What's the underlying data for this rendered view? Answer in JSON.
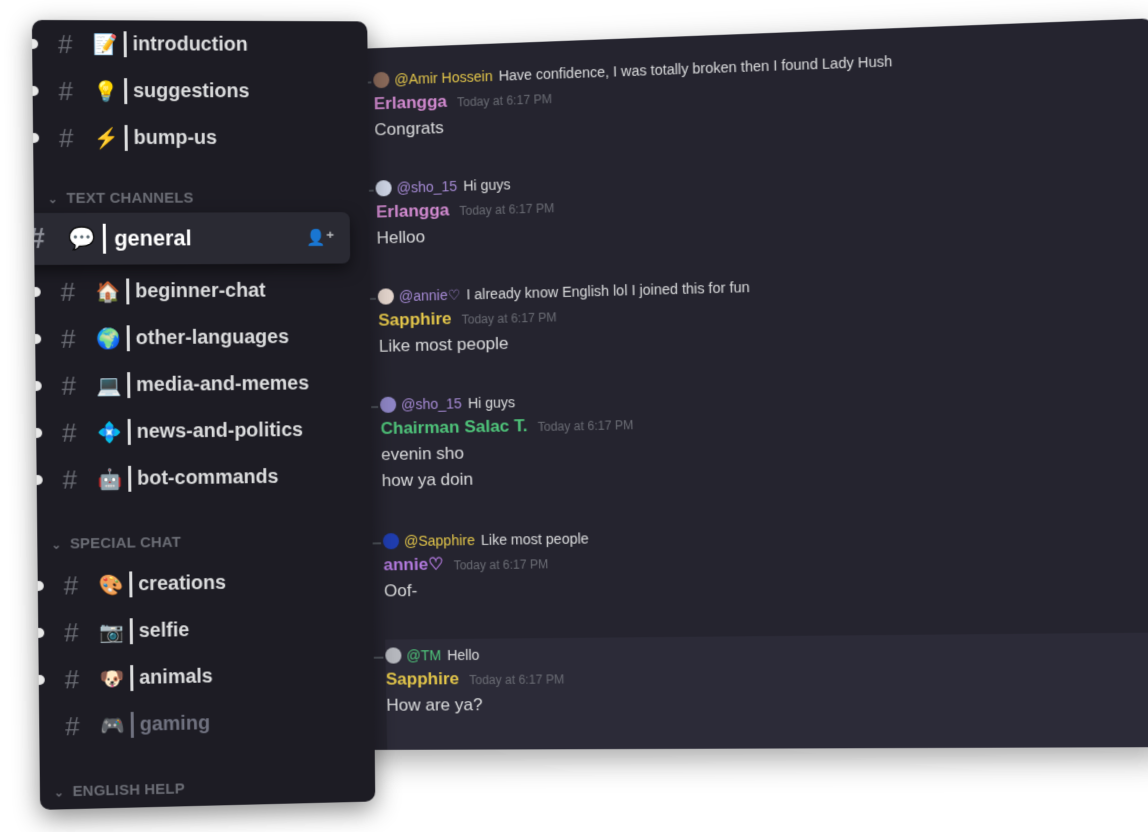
{
  "sidebar": {
    "channels_top": [
      {
        "name": "introduction",
        "emoji": "📝"
      },
      {
        "name": "suggestions",
        "emoji": "💡"
      },
      {
        "name": "bump-us",
        "emoji": "⚡"
      }
    ],
    "cat_text": "TEXT CHANNELS",
    "active_channel": {
      "name": "general",
      "emoji": "💬"
    },
    "text_channels": [
      {
        "name": "beginner-chat",
        "emoji": "🏠"
      },
      {
        "name": "other-languages",
        "emoji": "🌍"
      },
      {
        "name": "media-and-memes",
        "emoji": "💻"
      },
      {
        "name": "news-and-politics",
        "emoji": "💠"
      },
      {
        "name": "bot-commands",
        "emoji": "🤖"
      }
    ],
    "cat_special": "SPECIAL CHAT",
    "special_channels": [
      {
        "name": "creations",
        "emoji": "🎨"
      },
      {
        "name": "selfie",
        "emoji": "📷"
      },
      {
        "name": "animals",
        "emoji": "🐶"
      },
      {
        "name": "gaming",
        "emoji": "🎮"
      }
    ],
    "cat_english": "ENGLISH HELP"
  },
  "messages": [
    {
      "reply_user": "@Amir Hossein",
      "reply_text": "Have confidence, I was totally broken then I found Lady Hush",
      "reply_color": "#e3c64a",
      "author": "Erlangga",
      "author_color": "#d28ad0",
      "time": "Today at 6:17 PM",
      "lines": [
        "Congrats"
      ],
      "avatar": "discord"
    },
    {
      "reply_user": "@sho_15",
      "reply_text": "Hi guys",
      "reply_color": "#a78bd6",
      "author": "Erlangga",
      "author_color": "#d28ad0",
      "time": "Today at 6:17 PM",
      "lines": [
        "Helloo"
      ],
      "avatar": "discord"
    },
    {
      "reply_user": "@annie♡",
      "reply_text": "I already know English lol I joined this for fun",
      "reply_color": "#a78bd6",
      "author": "Sapphire",
      "author_color": "#e3c64a",
      "time": "Today at 6:17 PM",
      "lines": [
        "Like most people"
      ],
      "avatar": "blue"
    },
    {
      "reply_user": "@sho_15",
      "reply_text": "Hi guys",
      "reply_color": "#a78bd6",
      "author": "Chairman Salac T.",
      "author_color": "#4fc47a",
      "time": "Today at 6:17 PM",
      "lines": [
        "evenin sho",
        "how ya doin"
      ],
      "avatar": "grey"
    },
    {
      "reply_user": "@Sapphire",
      "reply_text": "Like most people",
      "reply_color": "#e3c64a",
      "author": "annie♡",
      "author_color": "#b37adf",
      "time": "Today at 6:17 PM",
      "lines": [
        "Oof-"
      ],
      "avatar": "annie"
    },
    {
      "reply_user": "@TM",
      "reply_text": "Hello",
      "reply_color": "#4fc47a",
      "author": "Sapphire",
      "author_color": "#e3c64a",
      "time": "Today at 6:17 PM",
      "lines": [
        "How are ya?"
      ],
      "avatar": "blue"
    }
  ]
}
